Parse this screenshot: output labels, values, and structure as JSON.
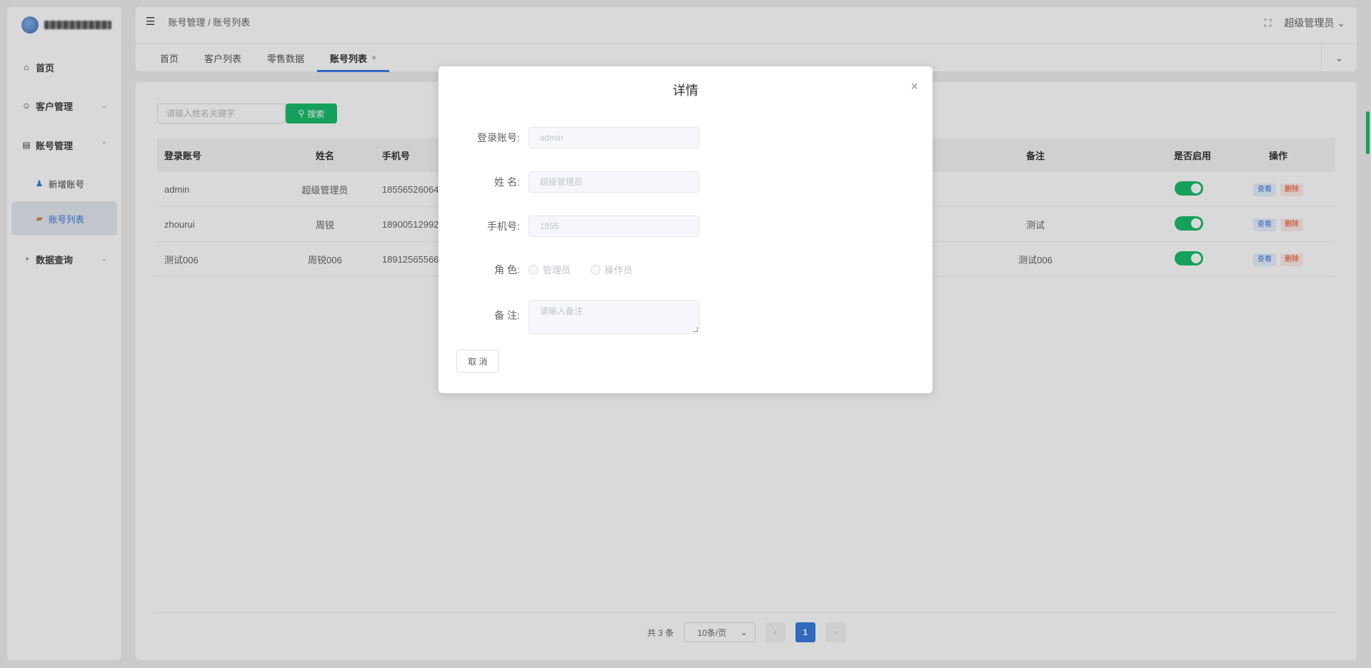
{
  "sidebar": {
    "menu": [
      {
        "label": "首页",
        "icon": "home-icon"
      },
      {
        "label": "客户管理",
        "icon": "user-icon",
        "expandable": true
      },
      {
        "label": "账号管理",
        "icon": "document-icon",
        "expandable": true,
        "expanded": true
      },
      {
        "label": "新增账号",
        "icon": "person-icon"
      },
      {
        "label": "账号列表",
        "icon": "list-icon",
        "active": true
      },
      {
        "label": "数据查询",
        "icon": "chart-icon",
        "expandable": true
      }
    ]
  },
  "header": {
    "breadcrumb": "账号管理 / 账号列表",
    "user_name": "超级管理员",
    "tabs": [
      {
        "label": "首页"
      },
      {
        "label": "客户列表"
      },
      {
        "label": "零售数据"
      },
      {
        "label": "账号列表",
        "active": true,
        "close": "×"
      }
    ]
  },
  "main": {
    "search_placeholder": "请输入姓名关键字",
    "search_button": "搜索",
    "table": {
      "headers": [
        "登录账号",
        "姓名",
        "手机号",
        "备注",
        "是否启用",
        "操作"
      ],
      "rows": [
        {
          "login": "admin",
          "name": "超级管理员",
          "phone": "18556526064",
          "note": "",
          "enabled": true
        },
        {
          "login": "zhourui",
          "name": "周锐",
          "phone": "18900512992",
          "note": "测试",
          "enabled": true
        },
        {
          "login": "测试006",
          "name": "周锐006",
          "phone": "18912565566",
          "note": "测试006",
          "enabled": true
        }
      ],
      "view_label": "查看",
      "delete_label": "删除"
    },
    "pagination": {
      "total": "共 3 条",
      "page_size": "10条/页",
      "current_page": "1",
      "prev": "‹",
      "next": "›"
    }
  },
  "dialog": {
    "title": "详情",
    "close": "×",
    "fields": {
      "login_label": "登录账号:",
      "login_value": "admin",
      "name_label": "姓 名:",
      "name_value": "超级管理员",
      "phone_label": "手机号:",
      "phone_value": "1855",
      "role_label": "角 色:",
      "role_options": [
        "管理员",
        "操作员"
      ],
      "note_label": "备 注:",
      "note_placeholder": "请输入备注"
    },
    "cancel_button": "取 消"
  }
}
